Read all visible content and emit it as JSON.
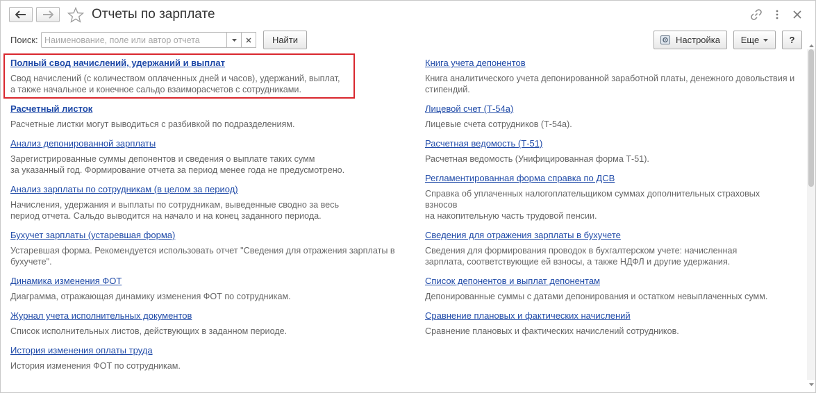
{
  "window": {
    "title": "Отчеты по зарплате"
  },
  "toolbar": {
    "search_label": "Поиск:",
    "search_placeholder": "Наименование, поле или автор отчета",
    "search_value": "",
    "find_button": "Найти",
    "settings_button": "Настройка",
    "more_button": "Еще",
    "help_button": "?"
  },
  "reports_left": [
    {
      "title": "Полный свод начислений, удержаний и выплат",
      "desc": [
        "Свод начислений (с количеством оплаченных дней и часов), удержаний, выплат,",
        "а также начальное и конечное сальдо взаиморасчетов с сотрудниками."
      ]
    },
    {
      "title": "Расчетный листок",
      "desc": [
        "Расчетные листки могут выводиться с разбивкой по подразделениям."
      ]
    },
    {
      "title": "Анализ депонированной зарплаты",
      "desc": [
        "Зарегистрированные суммы депонентов и сведения о выплате таких сумм",
        "за указанный год. Формирование отчета за период менее года не предусмотрено."
      ]
    },
    {
      "title": "Анализ зарплаты по сотрудникам (в целом за период)",
      "desc": [
        "Начисления, удержания и выплаты по сотрудникам, выведенные сводно за весь",
        "период отчета. Сальдо выводится на начало и на конец заданного периода."
      ]
    },
    {
      "title": "Бухучет зарплаты (устаревшая форма)",
      "desc": [
        "Устаревшая форма. Рекомендуется использовать отчет \"Сведения для отражения зарплаты в",
        "бухучете\"."
      ]
    },
    {
      "title": "Динамика изменения ФОТ",
      "desc": [
        "Диаграмма, отражающая динамику изменения ФОТ по сотрудникам."
      ]
    },
    {
      "title": "Журнал учета исполнительных документов",
      "desc": [
        "Список исполнительных листов, действующих в заданном периоде."
      ]
    },
    {
      "title": "История изменения оплаты труда",
      "desc": [
        "История изменения ФОТ по сотрудникам."
      ]
    }
  ],
  "reports_right": [
    {
      "title": "Книга учета депонентов",
      "desc": [
        "Книга аналитического учета депонированной заработной платы, денежного довольствия и",
        "стипендий."
      ]
    },
    {
      "title": "Лицевой счет (Т-54а)",
      "desc": [
        "Лицевые счета сотрудников (Т-54а)."
      ]
    },
    {
      "title": "Расчетная ведомость (Т-51)",
      "desc": [
        "Расчетная ведомость (Унифицированная форма Т-51)."
      ]
    },
    {
      "title": "Регламентированная форма справка по ДСВ",
      "desc": [
        "Справка об уплаченных налогоплательщиком суммах дополнительных страховых",
        "взносов",
        "на накопительную часть трудовой пенсии."
      ]
    },
    {
      "title": "Сведения для отражения зарплаты в бухучете",
      "desc": [
        "Сведения для формирования проводок в бухгалтерском учете: начисленная",
        "зарплата, соответствующие ей взносы, а также НДФЛ и другие удержания."
      ]
    },
    {
      "title": "Список депонентов и выплат депонентам",
      "desc": [
        "Депонированные суммы с датами депонирования и остатком невыплаченных сумм."
      ]
    },
    {
      "title": "Сравнение плановых и фактических начислений",
      "desc": [
        "Сравнение плановых и фактических начислений сотрудников."
      ]
    }
  ],
  "icons": {
    "back": "arrow-left-icon",
    "forward": "arrow-right-icon",
    "favorite": "star-icon",
    "link": "link-icon",
    "menu": "more-vertical-icon",
    "close": "close-icon",
    "settings": "settings-icon",
    "dropdown": "chevron-down-icon",
    "clear": "clear-icon"
  },
  "colors": {
    "link": "#1f4aa8",
    "highlight_border": "#d9272e",
    "description": "#666666"
  }
}
